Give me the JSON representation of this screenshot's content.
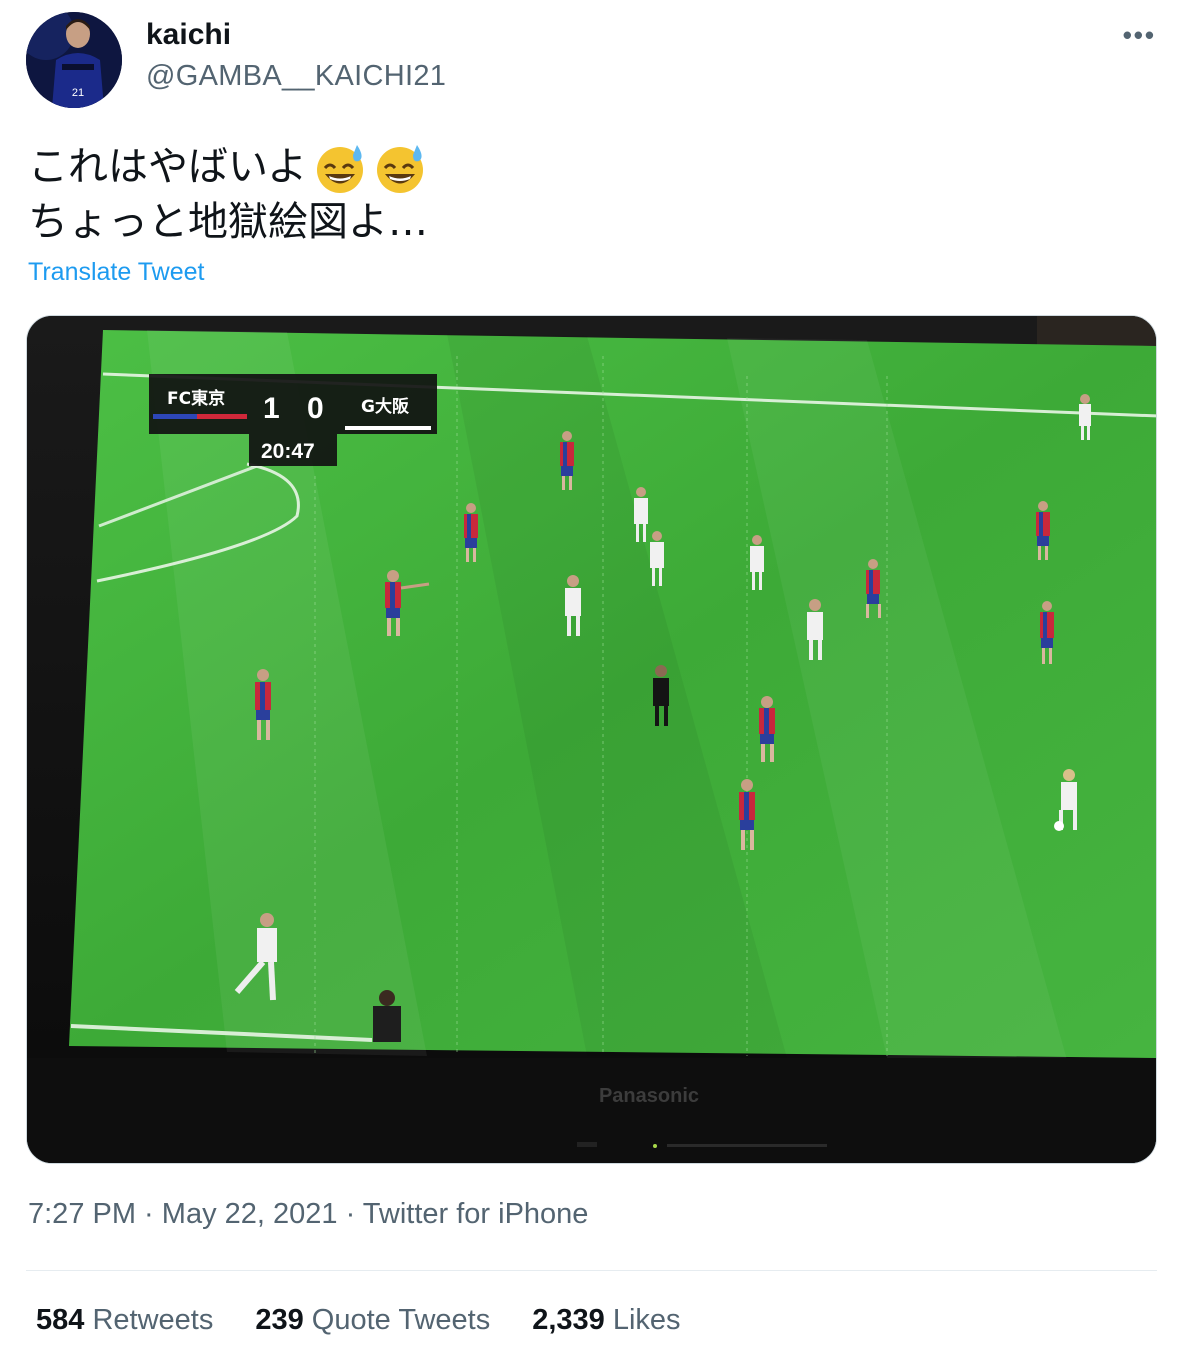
{
  "user": {
    "display_name": "kaichi",
    "handle": "@GAMBA__KAICHI21",
    "avatar_text": "21"
  },
  "more_label": "•••",
  "tweet": {
    "line1": "これはやばいよ",
    "line2": "ちょっと地獄絵図よ…",
    "emoji": [
      "sweat-smile-icon",
      "sweat-smile-icon"
    ]
  },
  "translate_label": "Translate Tweet",
  "media": {
    "scoreboard": {
      "home": "FC東京",
      "home_score": "1",
      "away_score": "0",
      "away": "G大阪",
      "clock": "20:47"
    },
    "tv_brand": "Panasonic"
  },
  "meta": {
    "time": "7:27 PM",
    "sep1": " · ",
    "date": "May 22, 2021",
    "sep2": " · ",
    "source": "Twitter for iPhone"
  },
  "stats": {
    "retweets_count": "584",
    "retweets_label": "Retweets",
    "quotes_count": "239",
    "quotes_label": "Quote Tweets",
    "likes_count": "2,339",
    "likes_label": "Likes"
  },
  "colors": {
    "link": "#1d9bf0",
    "secondary_text": "#536471",
    "pitch_green": "#3fae3a",
    "home_red": "#c8283c",
    "home_blue": "#2a3f9c"
  }
}
